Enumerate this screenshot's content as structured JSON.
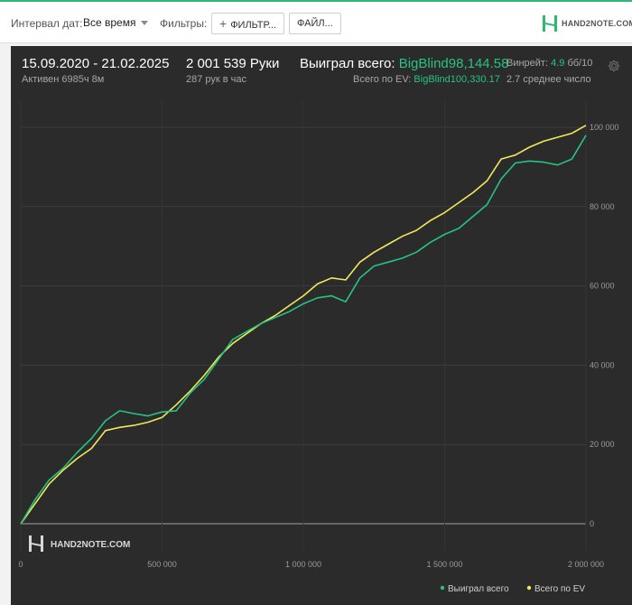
{
  "topbar": {
    "interval_label": "Интервал дат:",
    "interval_value": "Все время",
    "filters_label": "Фильтры:",
    "filters_button": "ФИЛЬТР...",
    "files_button": "ФАЙЛ...",
    "brand": "HAND2NOTE.COM"
  },
  "stats": {
    "date_range": "15.09.2020 - 21.02.2025",
    "active_time": "Активен 6985ч 8м",
    "hands": "2 001 539 Руки",
    "hands_per_hour": "287 рук в час",
    "won_label": "Выиграл всего:",
    "won_value": "BigBlind98,144.58",
    "ev_label": "Всего по EV:",
    "ev_value": "BigBlind100,330.17",
    "winrate_label": "Винрейт:",
    "winrate_value": "4.9",
    "winrate_unit": "бб/10",
    "avg_text": "2.7 среднее число"
  },
  "colors": {
    "won": "#25c483",
    "ev": "#f0e95a",
    "background": "#2b2b2b",
    "grid": "#3d3d3d",
    "brand_green": "#2eb872"
  },
  "watermark": "HAND2NOTE.COM",
  "chart_data": {
    "type": "line",
    "xlim": [
      0,
      2000000
    ],
    "ylim": [
      0,
      100000
    ],
    "x_ticks": [
      0,
      500000,
      1000000,
      1500000,
      2000000
    ],
    "x_tick_labels": [
      "0",
      "500 000",
      "1 000 000",
      "1 500 000",
      "2 000 000"
    ],
    "y_ticks": [
      0,
      20000,
      40000,
      60000,
      80000,
      100000
    ],
    "y_tick_labels": [
      "0",
      "20 000",
      "40 000",
      "60 000",
      "80 000",
      "100 000"
    ],
    "legend_position": "bottom-right",
    "x": [
      0,
      50000,
      100000,
      150000,
      200000,
      250000,
      300000,
      350000,
      400000,
      450000,
      500000,
      550000,
      600000,
      650000,
      700000,
      750000,
      800000,
      850000,
      900000,
      950000,
      1000000,
      1050000,
      1100000,
      1150000,
      1200000,
      1250000,
      1300000,
      1350000,
      1400000,
      1450000,
      1500000,
      1550000,
      1600000,
      1650000,
      1700000,
      1750000,
      1800000,
      1850000,
      1900000,
      1950000,
      2000000
    ],
    "series": [
      {
        "name": "Выиграл всего",
        "color": "#25c483",
        "values": [
          0,
          6000,
          11000,
          14000,
          18000,
          21500,
          26000,
          28500,
          27800,
          27200,
          28200,
          28500,
          33000,
          36500,
          41500,
          46500,
          48500,
          50500,
          52000,
          53500,
          55500,
          57000,
          57500,
          56000,
          62000,
          65000,
          66000,
          67000,
          68500,
          71000,
          73000,
          74500,
          77500,
          80500,
          87000,
          91000,
          91500,
          91200,
          90500,
          92000,
          98000
        ]
      },
      {
        "name": "Всего по EV",
        "color": "#f0e95a",
        "values": [
          0,
          5000,
          10000,
          13500,
          16500,
          19000,
          23500,
          24300,
          24800,
          25600,
          26800,
          30000,
          33500,
          37500,
          42000,
          45500,
          48000,
          50500,
          52500,
          55000,
          57500,
          60500,
          62000,
          61500,
          66000,
          68500,
          70500,
          72500,
          74000,
          76500,
          78500,
          81000,
          83500,
          86500,
          92000,
          93000,
          95000,
          96500,
          97500,
          98500,
          100500
        ]
      }
    ]
  }
}
